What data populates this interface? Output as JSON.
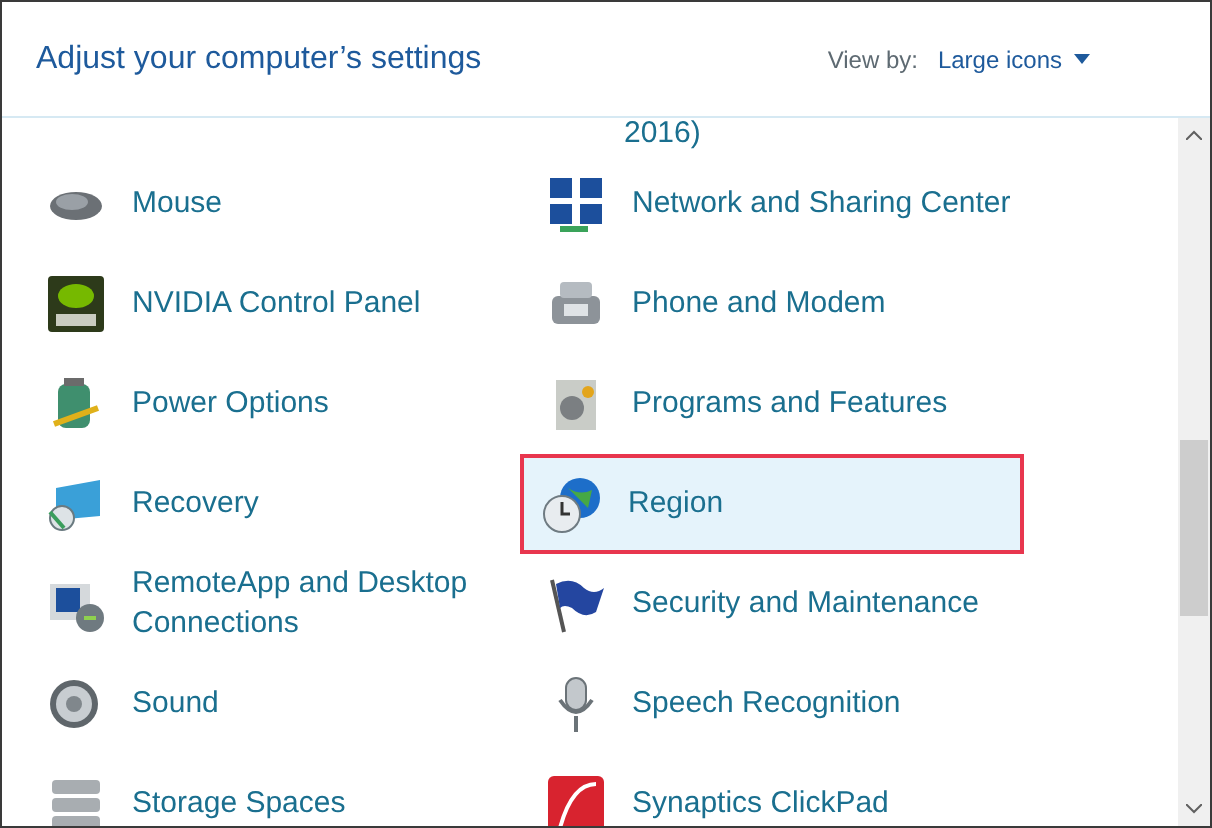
{
  "header": {
    "title": "Adjust your computer’s settings",
    "view_by_label": "View by:",
    "view_by_value": "Large icons"
  },
  "partial_item": {
    "label": "2016)"
  },
  "items": [
    {
      "label": "Mouse",
      "selected": false
    },
    {
      "label": "Network and Sharing Center",
      "selected": false
    },
    {
      "label": "NVIDIA Control Panel",
      "selected": false
    },
    {
      "label": "Phone and Modem",
      "selected": false
    },
    {
      "label": "Power Options",
      "selected": false
    },
    {
      "label": "Programs and Features",
      "selected": false
    },
    {
      "label": "Recovery",
      "selected": false
    },
    {
      "label": "Region",
      "selected": true
    },
    {
      "label": "RemoteApp and Desktop Connections",
      "selected": false
    },
    {
      "label": "Security and Maintenance",
      "selected": false
    },
    {
      "label": "Sound",
      "selected": false
    },
    {
      "label": "Speech Recognition",
      "selected": false
    },
    {
      "label": "Storage Spaces",
      "selected": false
    },
    {
      "label": "Synaptics ClickPad",
      "selected": false
    }
  ]
}
